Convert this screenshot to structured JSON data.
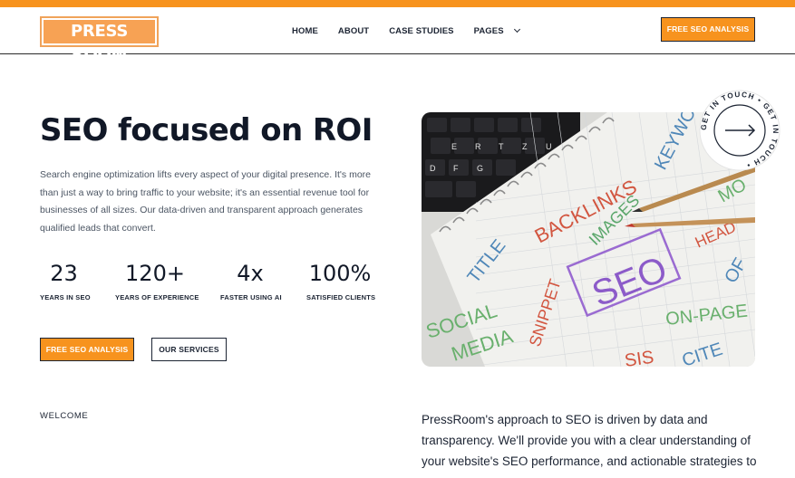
{
  "brand": {
    "logo_text": "PRESS ROOM",
    "accent_color": "#f7931e",
    "text_color": "#1c2433"
  },
  "nav": {
    "items": [
      "HOME",
      "ABOUT",
      "CASE STUDIES",
      "PAGES"
    ],
    "cta": "FREE SEO ANALYSIS"
  },
  "hero": {
    "title_pre": "SEO focused on ",
    "title_highlight": "ROI",
    "description": "Search engine optimization lifts every aspect of your digital presence. It's more than just a way to bring traffic to your website; it's an essential revenue tool for businesses of all sizes. Our data-driven and transparent approach generates qualified leads that convert.",
    "stats": [
      {
        "value": "23",
        "label": "YEARS IN SEO"
      },
      {
        "value": "120+",
        "label": "YEARS OF EXPERIENCE"
      },
      {
        "value": "4x",
        "label": "FASTER USING AI"
      },
      {
        "value": "100%",
        "label": "SATISFIED CLIENTS"
      }
    ],
    "primary_button": "FREE SEO ANALYSIS",
    "secondary_button": "OUR SERVICES",
    "image_words": [
      "BACKLINKS",
      "IMAGES",
      "KEYWORDS",
      "TITLE",
      "SEO",
      "SOCIAL",
      "MEDIA",
      "SNIPPET",
      "ON-PAGE",
      "HEAD",
      "MO",
      "OF",
      "CITE",
      "SIS"
    ],
    "keyboard_keys": [
      "E",
      "R",
      "T",
      "Z",
      "U",
      "D",
      "F",
      "G"
    ],
    "badge_text": "GET IN TOUCH • GET IN TOUCH • ",
    "badge_icon": "arrow-right-icon"
  },
  "welcome": {
    "eyebrow": "WELCOME",
    "text": "PressRoom's approach to SEO is driven by data and transparency. We'll provide you with a clear understanding of your website's SEO performance, and actionable strategies to"
  }
}
